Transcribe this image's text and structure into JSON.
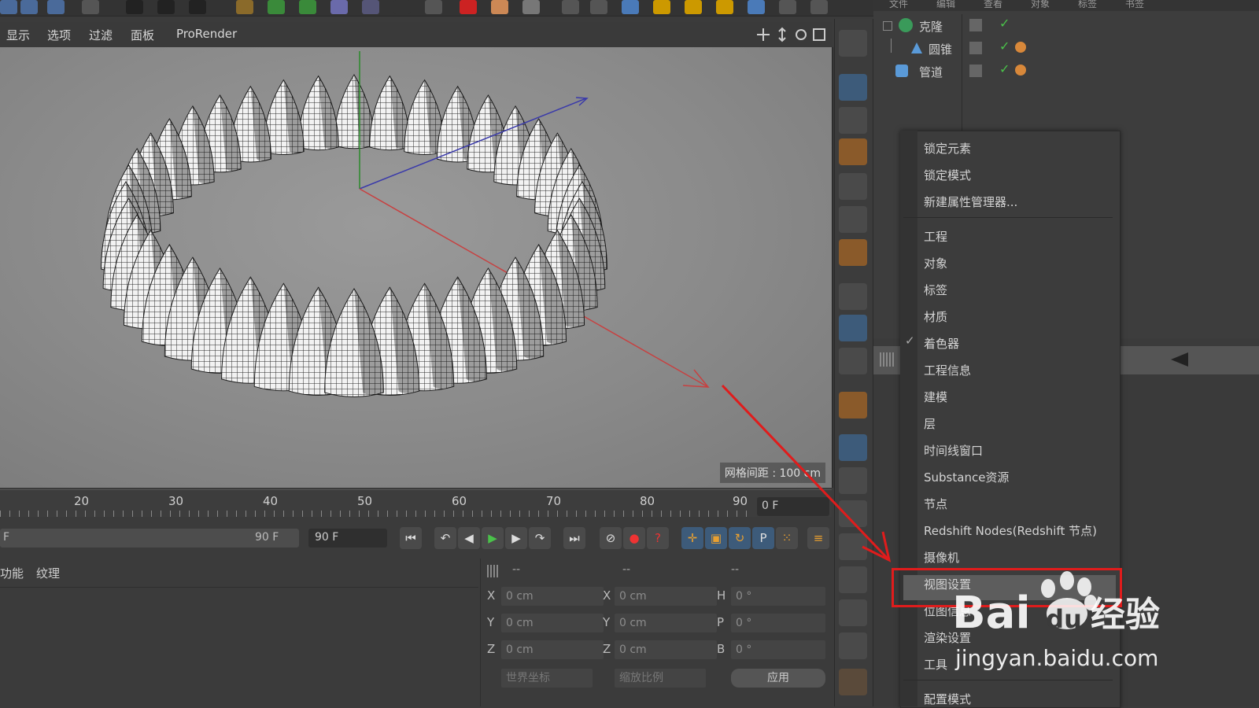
{
  "view_menu": [
    "显示",
    "选项",
    "过滤",
    "面板",
    "ProRender"
  ],
  "grid_spacing": "网格间距 : 100 cm",
  "object_manager": {
    "header_menu": [
      "文件",
      "编辑",
      "查看",
      "对象",
      "标签",
      "书签"
    ],
    "objects": [
      {
        "name": "克隆",
        "icon": "cloner-icon"
      },
      {
        "name": "圆锥",
        "icon": "cone-icon"
      },
      {
        "name": "管道",
        "icon": "tube-icon"
      }
    ]
  },
  "timeline": {
    "ticks": [
      "20",
      "30",
      "40",
      "50",
      "60",
      "70",
      "80",
      "90"
    ],
    "current_frame": "0 F",
    "range_end": "90 F",
    "range_field": "90 F",
    "range_start": "F"
  },
  "material_tabs": [
    "功能",
    "纹理"
  ],
  "coordinates": {
    "header": [
      "--",
      "--",
      "--"
    ],
    "rows": [
      {
        "axis1": "X",
        "val1": "0 cm",
        "axis2": "X",
        "val2": "0 cm",
        "axis3": "H",
        "val3": "0 °"
      },
      {
        "axis1": "Y",
        "val1": "0 cm",
        "axis2": "Y",
        "val2": "0 cm",
        "axis3": "P",
        "val3": "0 °"
      },
      {
        "axis1": "Z",
        "val1": "0 cm",
        "axis2": "Z",
        "val2": "0 cm",
        "axis3": "B",
        "val3": "0 °"
      }
    ],
    "world_coord": "世界坐标",
    "scale": "缩放比例",
    "apply": "应用"
  },
  "context_menu": {
    "group1": [
      "锁定元素",
      "锁定模式",
      "新建属性管理器..."
    ],
    "group2": [
      "工程",
      "对象",
      "标签",
      "材质",
      "着色器",
      "工程信息",
      "建模",
      "层",
      "时间线窗口",
      "Substance资源",
      "节点",
      "Redshift Nodes(Redshift 节点)",
      "摄像机",
      "视图设置",
      "位图信息",
      "渲染设置",
      "工具"
    ],
    "group3": [
      "配置模式"
    ],
    "checked_item": "着色器",
    "highlighted_item": "视图设置"
  },
  "watermark": {
    "brand": "Bai",
    "brand2": "du",
    "cn": "经验",
    "url": "jingyan.baidu.com"
  },
  "colors": {
    "highlight_box": "#e01c1c",
    "accent_blue": "#3d5b7a"
  }
}
